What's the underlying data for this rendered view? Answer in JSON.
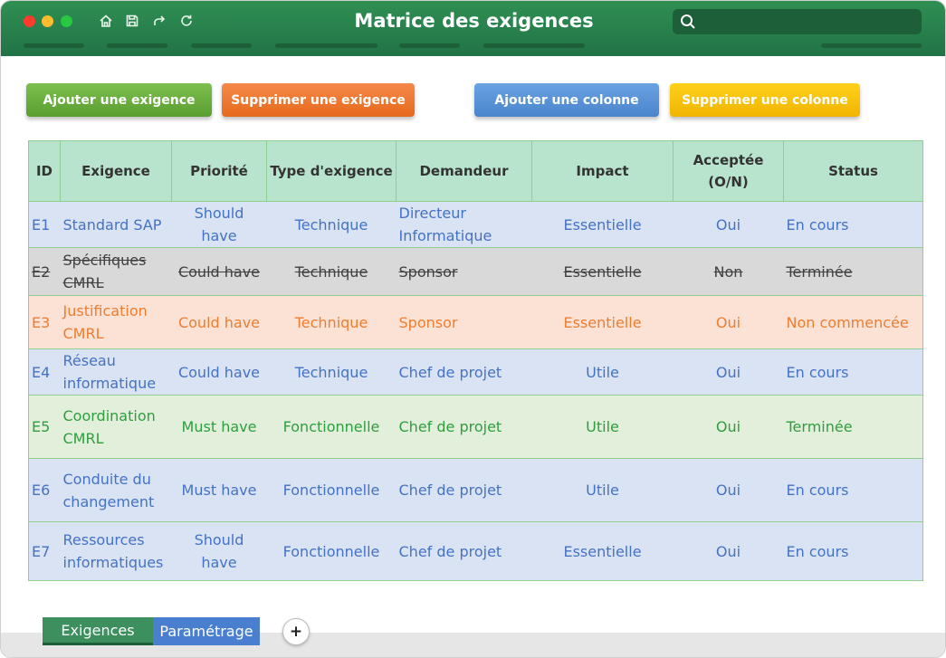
{
  "window": {
    "title": "Matrice des exigences"
  },
  "search": {
    "placeholder": ""
  },
  "toolbar": {
    "icons": [
      "home-icon",
      "save-icon",
      "share-icon",
      "refresh-icon"
    ]
  },
  "buttons": {
    "add_requirement": "Ajouter une exigence",
    "delete_requirement": "Supprimer une exigence",
    "add_column": "Ajouter une colonne",
    "delete_column": "Supprimer une colonne"
  },
  "table": {
    "headers": [
      "ID",
      "Exigence",
      "Priorité",
      "Type d'exigence",
      "Demandeur",
      "Impact",
      "Acceptée (O/N)",
      "Status"
    ],
    "rows": [
      {
        "id": "E1",
        "exigence": "Standard SAP",
        "priorite": "Should have",
        "type": "Technique",
        "demandeur": "Directeur Informatique",
        "impact": "Essentielle",
        "acceptee": "Oui",
        "status": "En cours",
        "bg": "#dae3f3",
        "color": "#4472c4",
        "strike": false
      },
      {
        "id": "E2",
        "exigence": "Spécifiques CMRL",
        "priorite": "Could have",
        "type": "Technique",
        "demandeur": "Sponsor",
        "impact": "Essentielle",
        "acceptee": "Non",
        "status": "Terminée",
        "bg": "#d9d9d9",
        "color": "#404040",
        "strike": true
      },
      {
        "id": "E3",
        "exigence": "Justification CMRL",
        "priorite": "Could have",
        "type": "Technique",
        "demandeur": "Sponsor",
        "impact": "Essentielle",
        "acceptee": "Oui",
        "status": "Non commencée",
        "bg": "#fbe2d5",
        "color": "#ed7d31",
        "strike": false
      },
      {
        "id": "E4",
        "exigence": "Réseau informatique",
        "priorite": "Could have",
        "type": "Technique",
        "demandeur": "Chef de projet",
        "impact": "Utile",
        "acceptee": "Oui",
        "status": "En cours",
        "bg": "#dae3f3",
        "color": "#4472c4",
        "strike": false
      },
      {
        "id": "E5",
        "exigence": "Coordination CMRL",
        "priorite": "Must have",
        "type": "Fonctionnelle",
        "demandeur": "Chef de projet",
        "impact": "Utile",
        "acceptee": "Oui",
        "status": "Terminée",
        "bg": "#e2efda",
        "color": "#2e9e3e",
        "strike": false
      },
      {
        "id": "E6",
        "exigence": "Conduite du changement",
        "priorite": "Must have",
        "type": "Fonctionnelle",
        "demandeur": "Chef de projet",
        "impact": "Utile",
        "acceptee": "Oui",
        "status": "En cours",
        "bg": "#dae3f3",
        "color": "#4472c4",
        "strike": false
      },
      {
        "id": "E7",
        "exigence": "Ressources informatiques",
        "priorite": "Should have",
        "type": "Fonctionnelle",
        "demandeur": "Chef de projet",
        "impact": "Essentielle",
        "acceptee": "Oui",
        "status": "En cours",
        "bg": "#dae3f3",
        "color": "#4472c4",
        "strike": false
      }
    ]
  },
  "sheet_tabs": {
    "items": [
      {
        "label": "Exigences",
        "active": true
      },
      {
        "label": "Paramétrage",
        "active": false
      }
    ],
    "add_label": "+"
  }
}
